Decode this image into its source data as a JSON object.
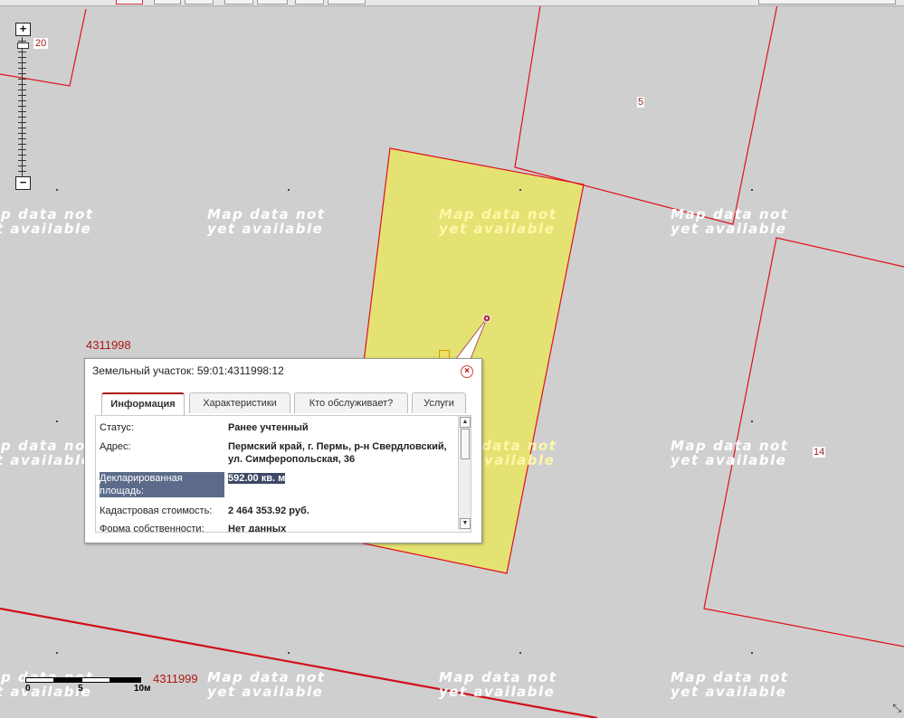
{
  "map": {
    "tile_text": "Map data not\nyet available",
    "zoom": {
      "plus": "+",
      "minus": "−",
      "level": "20"
    },
    "labels": {
      "block_a": "4311998",
      "block_b": "4311999",
      "parcel_5": "5",
      "parcel_14": "14"
    },
    "scale": {
      "tick0": "0",
      "tick5": "5",
      "tick10": "10м"
    },
    "colors": {
      "parcel_fill": "#e5e274",
      "boundary": "#e0101a",
      "background": "#cfcfcf"
    }
  },
  "popup": {
    "title": "Земельный участок: 59:01:4311998:12",
    "close": "×",
    "tabs": [
      {
        "label": "Информация"
      },
      {
        "label": "Характеристики"
      },
      {
        "label": "Кто обслуживает?"
      },
      {
        "label": "Услуги"
      }
    ],
    "rows": [
      {
        "key": "Статус:",
        "value": "Ранее учтенный"
      },
      {
        "key": "Адрес:",
        "value": "Пермский край, г. Пермь, р-н Свердловский, ул. Симферопольская, 36"
      },
      {
        "key": "Декларированная площадь:",
        "value": "592.00 кв. м"
      },
      {
        "key": "Кадастровая стоимость:",
        "value": "2 464 353.92 руб."
      },
      {
        "key": "Форма собственности:",
        "value": "Нет данных"
      }
    ]
  }
}
